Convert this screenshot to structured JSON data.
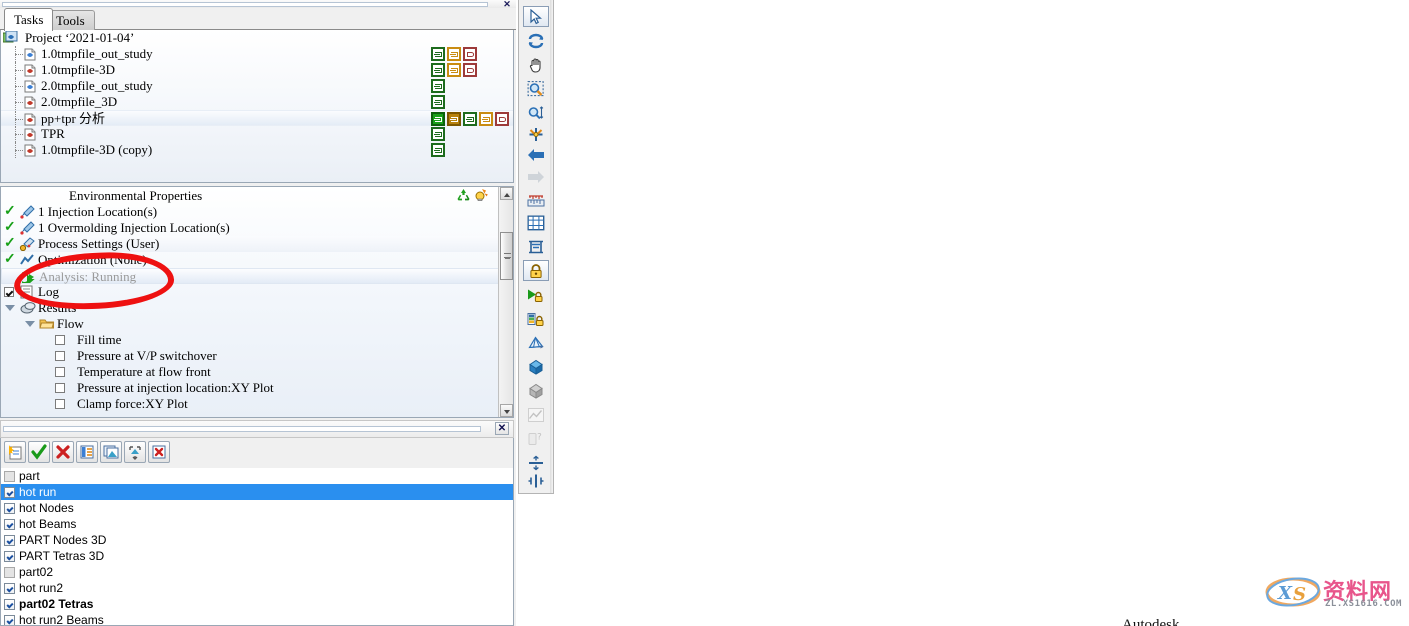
{
  "window": {
    "close_glyph": "✕"
  },
  "tabs": [
    {
      "label": "Tasks",
      "active": true
    },
    {
      "label": "Tools",
      "active": false
    }
  ],
  "project_tree": {
    "root": {
      "label": "Project ‘2021-01-04’",
      "icon": "project-icon"
    },
    "items": [
      {
        "label": "1.0tmpfile_out_study",
        "icon": "study-blue-icon",
        "selected": false,
        "badges": [
          {
            "kind": "green",
            "filled": false
          },
          {
            "kind": "amber",
            "filled": false
          },
          {
            "kind": "dred",
            "filled": false
          }
        ]
      },
      {
        "label": "1.0tmpfile-3D",
        "icon": "study-red-icon",
        "selected": false,
        "badges": [
          {
            "kind": "green",
            "filled": false
          },
          {
            "kind": "amber",
            "filled": false
          },
          {
            "kind": "dred",
            "filled": false
          }
        ]
      },
      {
        "label": "2.0tmpfile_out_study",
        "icon": "study-blue-icon",
        "selected": false,
        "badges": [
          {
            "kind": "green",
            "filled": false
          }
        ]
      },
      {
        "label": "2.0tmpfile_3D",
        "icon": "study-red-icon",
        "selected": false,
        "badges": [
          {
            "kind": "green",
            "filled": false
          }
        ]
      },
      {
        "label": "pp+tpr 分析",
        "icon": "study-red-icon",
        "selected": true,
        "badges": [
          {
            "kind": "green",
            "filled": true
          },
          {
            "kind": "amber",
            "filled": true
          },
          {
            "kind": "green",
            "filled": false
          },
          {
            "kind": "amber",
            "filled": false
          },
          {
            "kind": "dred",
            "filled": false
          }
        ]
      },
      {
        "label": "TPR",
        "icon": "study-red-icon",
        "selected": false,
        "badges": [
          {
            "kind": "green",
            "filled": false
          }
        ]
      },
      {
        "label": "1.0tmpfile-3D (copy)",
        "icon": "study-red-icon",
        "selected": false,
        "badges": [
          {
            "kind": "green",
            "filled": false
          }
        ]
      }
    ]
  },
  "study_panel": {
    "header": "Environmental Properties",
    "header_icons": [
      "recycle-icon",
      "lightbulb-icon"
    ],
    "rows": [
      {
        "label": "1 Injection Location(s)",
        "check": "green-tick",
        "icon": "injection-location-icon"
      },
      {
        "label": "1 Overmolding Injection Location(s)",
        "check": "green-tick",
        "icon": "overmolding-injection-icon"
      },
      {
        "label": "Process Settings (User)",
        "check": "green-tick",
        "icon": "process-settings-icon",
        "highlight": true
      },
      {
        "label": "Optimization (None)",
        "check": "green-tick",
        "icon": "optimization-icon"
      },
      {
        "label": "Analysis: Running",
        "check": "running-arrow",
        "icon": "running-icon",
        "selected": true,
        "greyed": true
      },
      {
        "label": "Log",
        "check": "checkbox-checked",
        "icon": "log-icon"
      },
      {
        "label": "Results",
        "check": "expander-open",
        "icon": "results-icon"
      },
      {
        "label": "Flow",
        "check": "expander-open",
        "icon": "folder-icon",
        "indent": 2
      },
      {
        "label": "Fill time",
        "check": "checkbox",
        "indent": 3
      },
      {
        "label": "Pressure at V/P switchover",
        "check": "checkbox",
        "indent": 3
      },
      {
        "label": "Temperature at flow front",
        "check": "checkbox",
        "indent": 3
      },
      {
        "label": "Pressure at injection location:XY Plot",
        "check": "checkbox",
        "indent": 3
      },
      {
        "label": "Clamp force:XY Plot",
        "check": "checkbox",
        "indent": 3
      }
    ]
  },
  "annotation": {
    "shape": "red-ellipse",
    "color": "#ee1111",
    "targets": "Optimization / Analysis: Running"
  },
  "layer_toolbar": {
    "buttons": [
      {
        "name": "new-layer-button",
        "icon": "new-layer-icon"
      },
      {
        "name": "activate-layer-button",
        "icon": "green-check-icon"
      },
      {
        "name": "deactivate-layer-button",
        "icon": "red-x-icon"
      },
      {
        "name": "layer-properties-button",
        "icon": "list-properties-icon"
      },
      {
        "name": "show-all-layers-button",
        "icon": "show-layer-icon"
      },
      {
        "name": "expand-layers-button",
        "icon": "expand-arrows-icon"
      },
      {
        "name": "delete-layer-button",
        "icon": "delete-layer-icon"
      }
    ]
  },
  "layers": [
    {
      "label": "part",
      "checked": false,
      "selected": false,
      "bold": false
    },
    {
      "label": "hot  run",
      "checked": true,
      "selected": true,
      "bold": false
    },
    {
      "label": "hot  Nodes",
      "checked": true,
      "selected": false,
      "bold": false
    },
    {
      "label": "hot   Beams",
      "checked": true,
      "selected": false,
      "bold": false
    },
    {
      "label": "PART Nodes 3D",
      "checked": true,
      "selected": false,
      "bold": false
    },
    {
      "label": "PART Tetras 3D",
      "checked": true,
      "selected": false,
      "bold": false
    },
    {
      "label": "part02",
      "checked": false,
      "selected": false,
      "bold": false
    },
    {
      "label": "hot run2",
      "checked": true,
      "selected": false,
      "bold": false
    },
    {
      "label": "part02 Tetras",
      "checked": true,
      "selected": false,
      "bold": true
    },
    {
      "label": "hot run2  Beams",
      "checked": true,
      "selected": false,
      "bold": false
    }
  ],
  "view_toolbar": {
    "buttons": [
      {
        "name": "select-cursor-tool",
        "icon": "cursor-arrow-icon",
        "active": true,
        "disabled": false
      },
      {
        "name": "rotate-tool",
        "icon": "rotate-icon",
        "active": false,
        "disabled": false
      },
      {
        "name": "pan-tool",
        "icon": "hand-pan-icon",
        "active": false,
        "disabled": false
      },
      {
        "name": "zoom-window-tool",
        "icon": "zoom-window-icon",
        "active": false,
        "disabled": false
      },
      {
        "name": "dynamic-zoom-tool",
        "icon": "zoom-dynamic-icon",
        "active": false,
        "disabled": false
      },
      {
        "name": "center-view-tool",
        "icon": "center-target-icon",
        "active": false,
        "disabled": false
      },
      {
        "name": "previous-view-button",
        "icon": "arrow-left-icon",
        "active": false,
        "disabled": false
      },
      {
        "name": "next-view-button",
        "icon": "arrow-right-icon",
        "active": false,
        "disabled": true
      },
      {
        "name": "measure-tool",
        "icon": "ruler-icon",
        "active": false,
        "disabled": false
      },
      {
        "name": "fit-view-button",
        "icon": "fit-frame-icon",
        "active": false,
        "disabled": false
      },
      {
        "name": "iso-view-button",
        "icon": "iso-view-icon",
        "active": false,
        "disabled": false
      },
      {
        "name": "lock-view-button",
        "icon": "lock-icon",
        "active": true,
        "disabled": false
      },
      {
        "name": "animate-lock-button",
        "icon": "play-lock-icon",
        "active": false,
        "disabled": false
      },
      {
        "name": "legend-lock-button",
        "icon": "legend-lock-icon",
        "active": false,
        "disabled": false
      },
      {
        "name": "mesh-display-button",
        "icon": "mesh-icon",
        "active": false,
        "disabled": false
      },
      {
        "name": "shaded-view-button",
        "icon": "solid-cube-icon",
        "active": false,
        "disabled": false
      },
      {
        "name": "transparent-view-button",
        "icon": "transparent-cube-icon",
        "active": false,
        "disabled": false
      },
      {
        "name": "xy-plot-button",
        "icon": "xy-plot-icon",
        "active": false,
        "disabled": true
      },
      {
        "name": "query-button",
        "icon": "query-icon",
        "active": false,
        "disabled": true
      },
      {
        "name": "section-plane-button",
        "icon": "section-plane-icon",
        "active": false,
        "disabled": false
      },
      {
        "name": "clip-plane-button",
        "icon": "clip-plane-icon",
        "active": false,
        "disabled": false
      }
    ]
  },
  "viewport": {
    "model_name": "injection-mold-runner-mesh",
    "colors": {
      "part_slab_side": "#00d2d2",
      "part_slab_top_mesh": "#1a1a1a",
      "hot_runner_red": "#cc0e0e",
      "cold_runner_tan": "#cdbfa5",
      "injection_cone_top": "#00c8d8",
      "injection_cone_body": "#c8c800",
      "background": "#ffffff"
    },
    "clipped_bottom_text": "Autodesk"
  },
  "watermark": {
    "logo_text": "XS",
    "title": "资料网",
    "url": "ZL.XS1616.COM"
  }
}
